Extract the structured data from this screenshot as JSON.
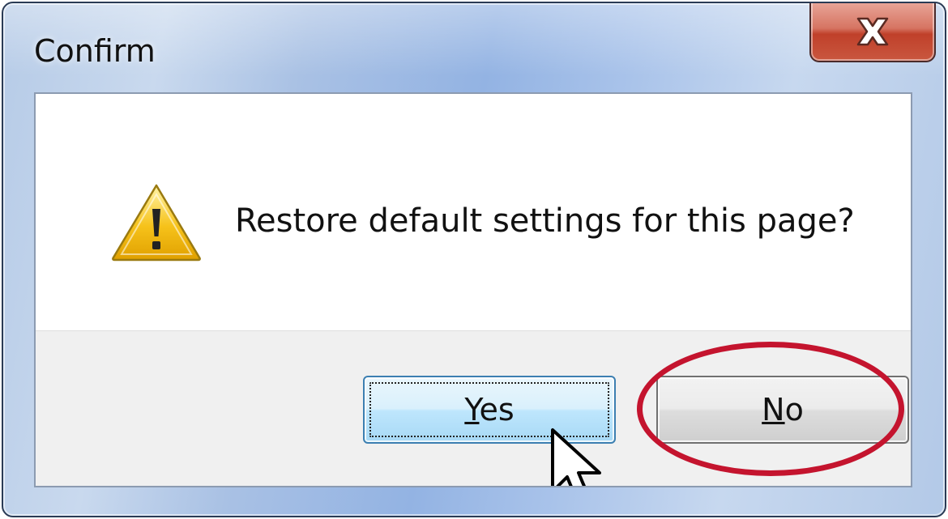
{
  "dialog": {
    "title": "Confirm",
    "message": "Restore default settings for this page?"
  },
  "titlebar": {
    "close_icon": "close-icon"
  },
  "icons": {
    "warning": "warning-icon",
    "cursor": "mouse-pointer-icon"
  },
  "buttons": {
    "yes": {
      "label_mnemonic": "Y",
      "label_rest": "es",
      "state": "hover-focused"
    },
    "no": {
      "label_mnemonic": "N",
      "label_rest": "o",
      "state": "highlighted"
    }
  },
  "colors": {
    "highlight_ring": "#c4142e",
    "close_button": "#c0402a",
    "warning_yellow": "#f6c21a"
  }
}
